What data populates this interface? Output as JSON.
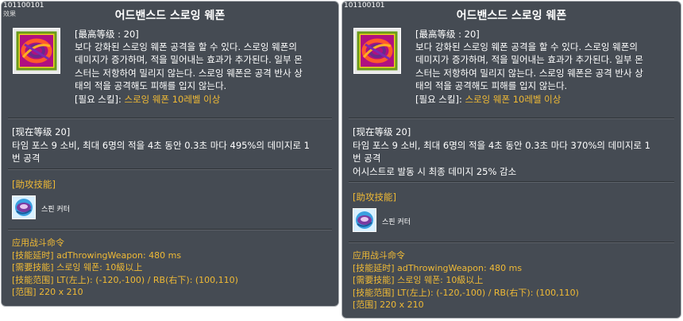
{
  "panels": [
    {
      "skill_id": "101100101",
      "corner_tag": "效果",
      "title": "어드밴스드 스로잉 웨폰",
      "max_level": "[最高等级 : 20]",
      "description_lines": [
        "보다 강화된 스로잉 웨폰 공격을 할 수 있다. 스로잉 웨폰의",
        "데미지가 증가하며, 적을 밀어내는 효과가 추가된다. 일부 몬",
        "스터는 저항하여 밀리지 않는다. 스로잉 웨폰은 공격 반사 상",
        "태의 적을 공격해도 피해를 입지 않는다."
      ],
      "required_label": "[필요 스킬]: ",
      "required_value": "스로잉 웨폰 10레벨 이상",
      "current_level": "[现在等级 20]",
      "level_lines": [
        "타임 포스 9 소비, 최대 6명의 적을 4초 동안 0.3초 마다 495%의 데미지로 1",
        "번 공격"
      ],
      "assist_label": "[助攻技能]",
      "assist_skill_name": "스핀 커터",
      "combat_title": "应用战斗命令",
      "combat_lines": [
        {
          "key": "[技能延时]",
          "value": " adThrowingWeapon: 480 ms"
        },
        {
          "key": "[需要技能]",
          "value": " 스로잉 웨폰: 10級以上"
        },
        {
          "key": "[技能范围]",
          "value": " LT(左上): (-120,-100) / RB(右下): (100,110)"
        },
        {
          "key": "[范围]",
          "value": " 220 x 210"
        }
      ]
    },
    {
      "skill_id": "101100101",
      "corner_tag": "",
      "title": "어드밴스드 스로잉 웨폰",
      "max_level": "[最高等级 : 20]",
      "description_lines": [
        "보다 강화된 스로잉 웨폰 공격을 할 수 있다. 스로잉 웨폰의",
        "데미지가 증가하며, 적을 밀어내는 효과가 추가된다. 일부 몬",
        "스터는 저항하여 밀리지 않는다. 스로잉 웨폰은 공격 반사 상",
        "태의 적을 공격해도 피해를 입지 않는다."
      ],
      "required_label": "[필요 스킬]: ",
      "required_value": "스로잉 웨폰 10레벨 이상",
      "current_level": "[现在等级 20]",
      "level_lines": [
        "타임 포스 9 소비, 최대 6명의 적을 4초 동안 0.3초 마다 370%의 데미지로 1",
        "번 공격",
        "어시스트로 발동 시 최종 데미지 25% 감소"
      ],
      "assist_label": "[助攻技能]",
      "assist_skill_name": "스핀 커터",
      "combat_title": "应用战斗命令",
      "combat_lines": [
        {
          "key": "[技能延时]",
          "value": " adThrowingWeapon: 480 ms"
        },
        {
          "key": "[需要技能]",
          "value": " 스로잉 웨폰: 10級以上"
        },
        {
          "key": "[技能范围]",
          "value": " LT(左上): (-120,-100) / RB(右下): (100,110)"
        },
        {
          "key": "[范围]",
          "value": " 220 x 210"
        }
      ]
    }
  ],
  "colors": {
    "panel_bg": "#454b53",
    "panel_border": "#a9adb1",
    "highlight_orange": "#f0ba35",
    "text": "#ffffff"
  }
}
